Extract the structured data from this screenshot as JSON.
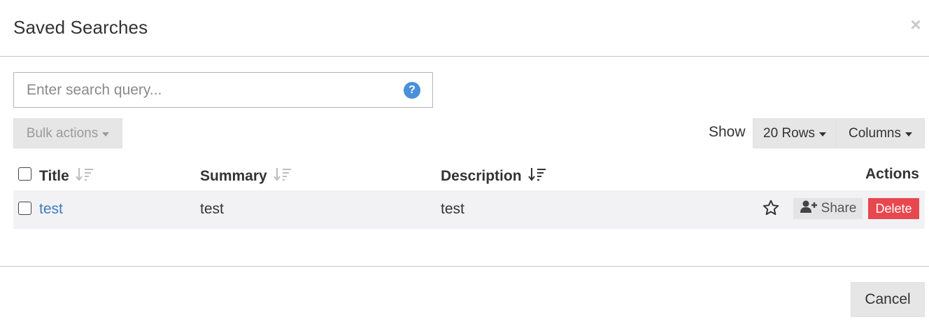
{
  "dialog": {
    "title": "Saved Searches",
    "close_glyph": "×"
  },
  "search": {
    "placeholder": "Enter search query...",
    "value": "",
    "help_glyph": "?"
  },
  "toolbar": {
    "bulk_actions_label": "Bulk actions",
    "show_label": "Show",
    "rows_label": "20 Rows",
    "columns_label": "Columns"
  },
  "table": {
    "headers": {
      "title": "Title",
      "summary": "Summary",
      "description": "Description",
      "actions": "Actions"
    },
    "rows": [
      {
        "title": "test",
        "summary": "test",
        "description": "test",
        "share_label": "Share",
        "delete_label": "Delete"
      }
    ]
  },
  "footer": {
    "cancel_label": "Cancel"
  },
  "colors": {
    "link": "#3b7bbf",
    "delete": "#e8474f",
    "help_icon": "#4a90d9",
    "row_background": "#f2f2f4"
  }
}
